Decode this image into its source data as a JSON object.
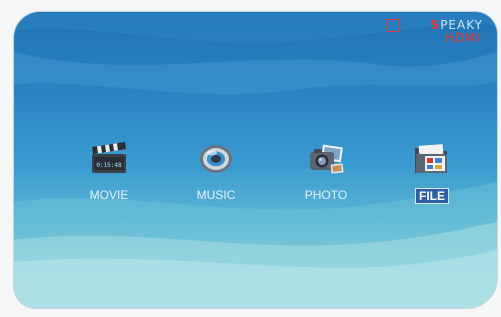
{
  "brand": {
    "line1_s": "S",
    "line1_rest": "PEAKY",
    "line2": "HDMI",
    "box_text": "SO"
  },
  "menu": {
    "items": [
      {
        "label": "MOVIE",
        "icon": "clapperboard-icon"
      },
      {
        "label": "MUSIC",
        "icon": "speaker-disc-icon"
      },
      {
        "label": "PHOTO",
        "icon": "camera-photos-icon"
      },
      {
        "label": "FILE",
        "icon": "folder-files-icon",
        "selected": true
      }
    ]
  },
  "colors": {
    "background_top": "#1f72b5",
    "background_bottom": "#a9dfe3",
    "brand_red": "#e23b2e",
    "selection": "#2e5fa6"
  }
}
